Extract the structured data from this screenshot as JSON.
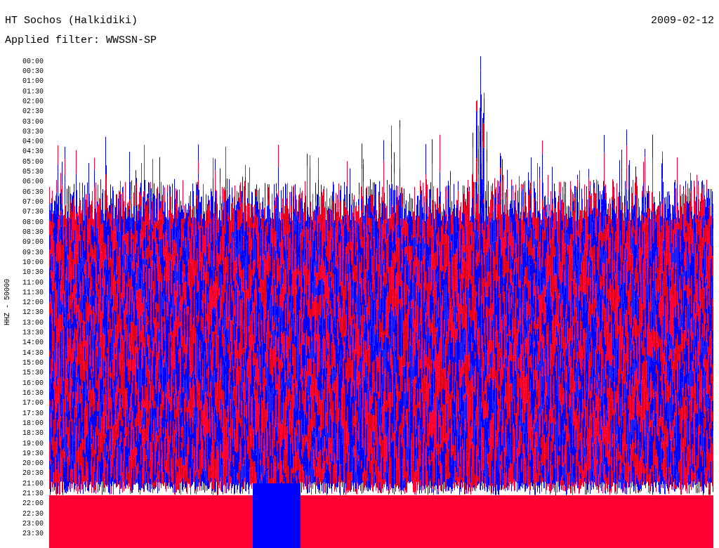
{
  "header": {
    "station": "HT Sochos (Halkidiki)",
    "date": "2009-02-12",
    "filter": "Applied filter: WWSSN-SP"
  },
  "axis_label": "HHZ - 50000",
  "time_labels": [
    "00:00",
    "00:30",
    "01:00",
    "01:30",
    "02:00",
    "02:30",
    "03:00",
    "03:30",
    "04:00",
    "04:30",
    "05:00",
    "05:30",
    "06:00",
    "06:30",
    "07:00",
    "07:30",
    "08:00",
    "08:30",
    "09:00",
    "09:30",
    "10:00",
    "10:30",
    "11:00",
    "11:30",
    "12:00",
    "12:30",
    "13:00",
    "13:30",
    "14:00",
    "14:30",
    "15:00",
    "15:30",
    "16:00",
    "16:30",
    "17:00",
    "17:30",
    "18:00",
    "18:30",
    "19:00",
    "19:30",
    "20:00",
    "20:30",
    "21:00",
    "21:30",
    "22:00",
    "22:30",
    "23:00",
    "23:30"
  ]
}
